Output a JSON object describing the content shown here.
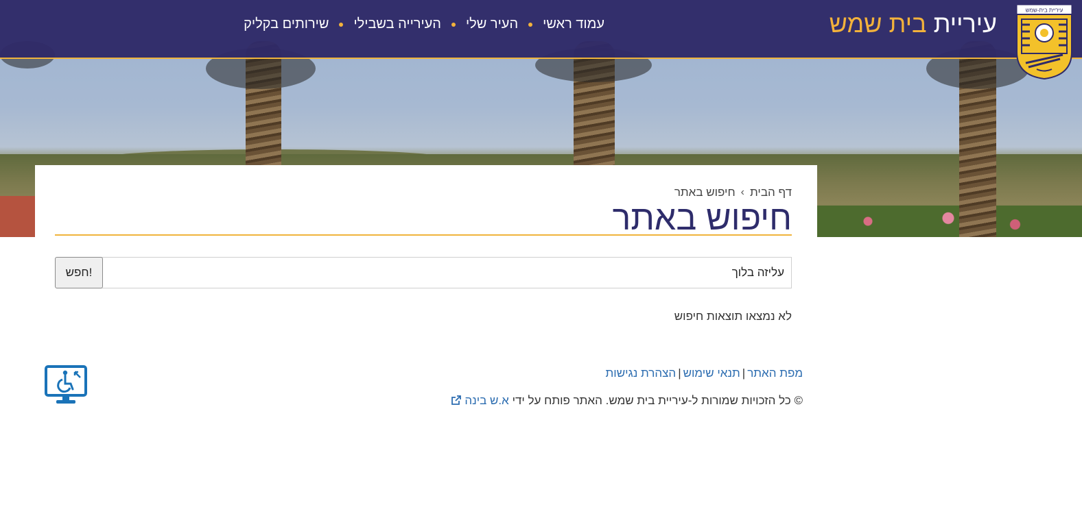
{
  "header": {
    "title_main": "עיריית",
    "title_accent": "בית שמש",
    "emblem_text": "עיריית בית-שמש",
    "nav": [
      {
        "label": "עמוד ראשי"
      },
      {
        "label": "העיר שלי"
      },
      {
        "label": "העירייה בשבילי"
      },
      {
        "label": "שירותים בקליק"
      }
    ]
  },
  "breadcrumb": {
    "home": "דף הבית",
    "separator": "›",
    "current": "חיפוש באתר"
  },
  "page": {
    "title": "חיפוש באתר"
  },
  "search": {
    "value": "עליזה בלוך",
    "button_label": "חפש!",
    "no_results": "לא נמצאו תוצאות חיפוש"
  },
  "footer": {
    "links": [
      {
        "label": "מפת האתר"
      },
      {
        "label": "תנאי שימוש"
      },
      {
        "label": "הצהרת נגישות"
      }
    ],
    "copyright_text": "© כל הזכויות שמורות ל-עיריית בית שמש. האתר פותח על ידי",
    "developer_link": "א.ש בינה"
  },
  "colors": {
    "header_bg": "#2f2a68",
    "accent": "#f3b23b",
    "title": "#2e2c6b",
    "link": "#2b6cb0"
  },
  "icons": {
    "accessibility": "accessibility-monitor-icon",
    "external": "external-link-icon"
  }
}
